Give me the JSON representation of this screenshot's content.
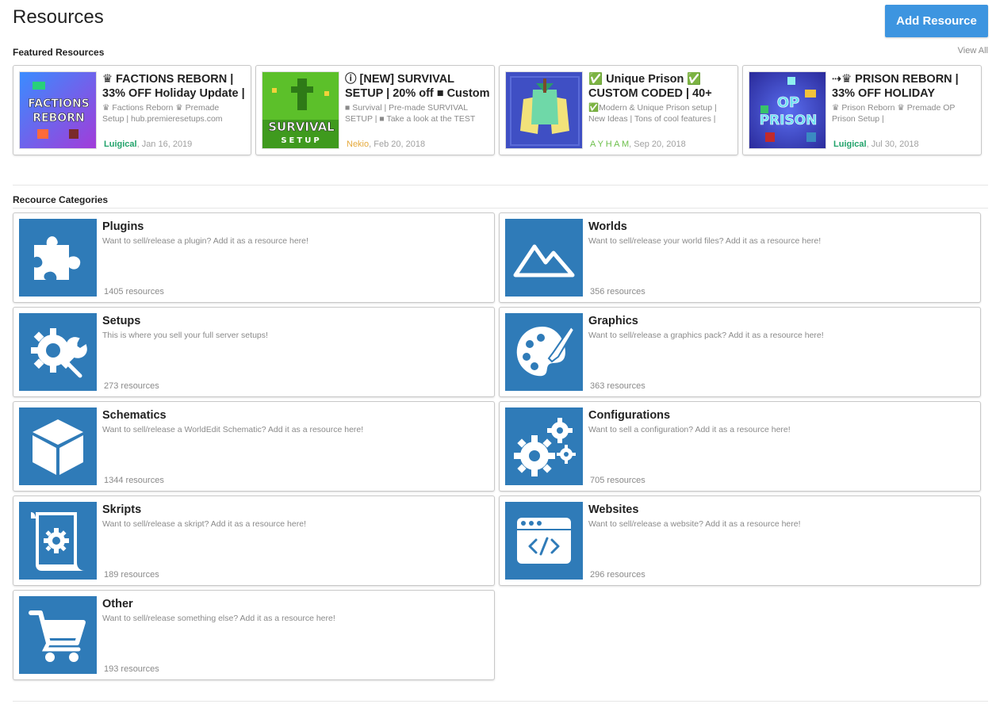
{
  "header": {
    "title": "Resources",
    "add_button": "Add Resource"
  },
  "featured": {
    "title": "Featured Resources",
    "view_all": "View All",
    "items": [
      {
        "line1": "♛ FACTIONS REBORN |",
        "line2": "33% OFF Holiday Update |",
        "desc1": "♛ Factions Reborn ♛ Premade",
        "desc2": "Setup | hub.premieresetups.com",
        "author": "Luigical",
        "author_color": "#22a36b",
        "date": "Jan 16, 2019",
        "thumb_text1": "FACTIONS",
        "thumb_text2": "REBORN"
      },
      {
        "line1": "ⓘ [NEW] SURVIVAL",
        "line2": "SETUP | 20% off ■ Custom",
        "desc1": "■ Survival | Pre-made SURVIVAL",
        "desc2": "SETUP | ■ Take a look at the TEST",
        "author": "Nekio",
        "author_color": "#e5a93a",
        "date": "Feb 20, 2018",
        "thumb_text1": "SURVIVAL",
        "thumb_text2": "SETUP"
      },
      {
        "line1": "✅ Unique Prison ✅",
        "line2": "CUSTOM CODED | 40+",
        "desc1": "✅Modern & Unique Prison setup |",
        "desc2": "New Ideas | Tons of cool features |",
        "author": "A Y H A M",
        "author_color": "#6cbf4a",
        "date": "Sep 20, 2018",
        "thumb_text1": "",
        "thumb_text2": ""
      },
      {
        "line1": "⇢♛ PRISON REBORN |",
        "line2": "33% OFF HOLIDAY",
        "desc1": "♛ Prison Reborn ♛ Premade OP",
        "desc2": "Prison Setup |",
        "author": "Luigical",
        "author_color": "#22a36b",
        "date": "Jul 30, 2018",
        "thumb_text1": "OP",
        "thumb_text2": "PRISON"
      }
    ]
  },
  "categories": {
    "title": "Recource Categories",
    "items": [
      {
        "name": "Plugins",
        "desc": "Want to sell/release a plugin? Add it as a resource here!",
        "count": "1405 resources",
        "icon": "puzzle-icon"
      },
      {
        "name": "Worlds",
        "desc": "Want to sell/release your world files? Add it as a resource here!",
        "count": "356 resources",
        "icon": "mountain-icon"
      },
      {
        "name": "Setups",
        "desc": "This is where you sell your full server setups!",
        "count": "273 resources",
        "icon": "gear-wrench-icon"
      },
      {
        "name": "Graphics",
        "desc": "Want to sell/release a graphics pack? Add it as a resource here!",
        "count": "363 resources",
        "icon": "palette-icon"
      },
      {
        "name": "Schematics",
        "desc": "Want to sell/release a WorldEdit Schematic? Add it as a resource here!",
        "count": "1344 resources",
        "icon": "cube-icon"
      },
      {
        "name": "Configurations",
        "desc": "Want to sell a configuration? Add it as a resource here!",
        "count": "705 resources",
        "icon": "gears-icon"
      },
      {
        "name": "Skripts",
        "desc": "Want to sell/release a skript? Add it as a resource here!",
        "count": "189 resources",
        "icon": "scroll-gear-icon"
      },
      {
        "name": "Websites",
        "desc": "Want to sell/release a website? Add it as a resource here!",
        "count": "296 resources",
        "icon": "browser-code-icon"
      },
      {
        "name": "Other",
        "desc": "Want to sell/release something else? Add it as a resource here!",
        "count": "193 resources",
        "icon": "cart-icon"
      }
    ]
  }
}
